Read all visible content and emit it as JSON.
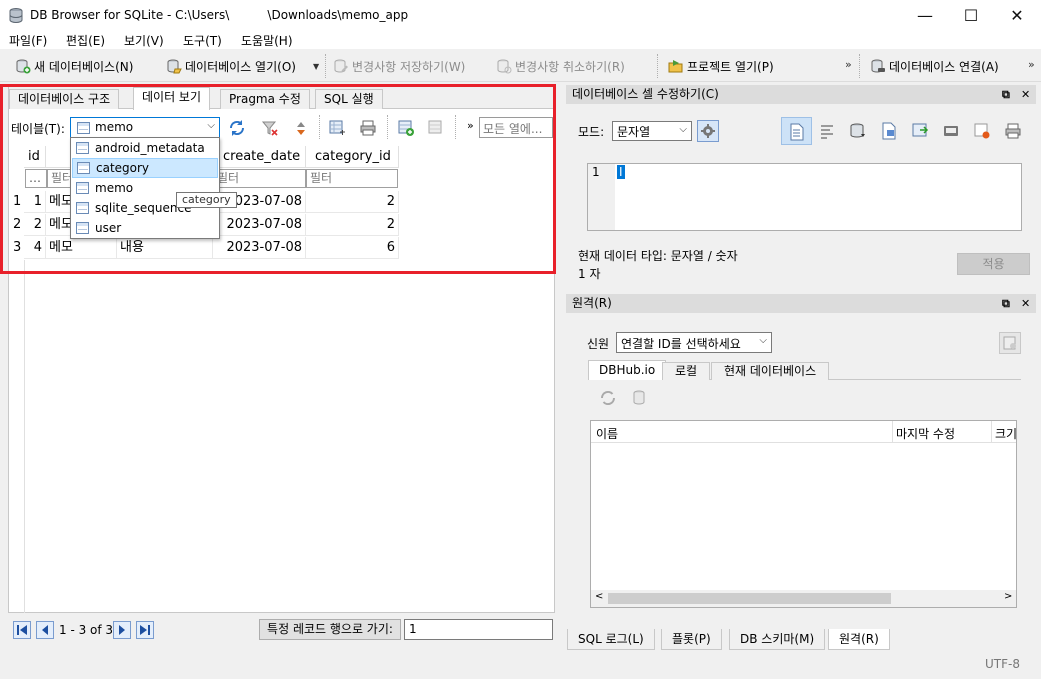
{
  "window": {
    "title": "DB Browser for SQLite - C:\\Users\\          \\Downloads\\memo_app",
    "minimize": "—",
    "maximize": "☐",
    "close": "✕"
  },
  "menu": [
    "파일(F)",
    "편집(E)",
    "보기(V)",
    "도구(T)",
    "도움말(H)"
  ],
  "toolbar": {
    "new_db": "새 데이터베이스(N)",
    "open_db": "데이터베이스 열기(O)",
    "write_changes": "변경사항 저장하기(W)",
    "revert_changes": "변경사항 취소하기(R)",
    "open_project": "프로젝트 열기(P)",
    "attach_db": "데이터베이스 연결(A)",
    "more": "»"
  },
  "left": {
    "tabs": [
      "데이터베이스 구조",
      "데이터 보기",
      "Pragma 수정",
      "SQL 실행"
    ],
    "active_tab": 1,
    "table_label": "테이블(T):",
    "table_selected": "memo",
    "more": "»",
    "filter_placeholder": "모든 열에...",
    "columns": [
      "id",
      "",
      "",
      "create_date",
      "category_id"
    ],
    "filter_text": "필터",
    "filter_dots": "…",
    "rows": [
      {
        "num": "1",
        "id": "1",
        "title": "메모",
        "content": "",
        "date": "2023-07-08",
        "cat": "2"
      },
      {
        "num": "2",
        "id": "2",
        "title": "메모",
        "content": "",
        "date": "2023-07-08",
        "cat": "2"
      },
      {
        "num": "3",
        "id": "4",
        "title": "메모",
        "content": "내용",
        "date": "2023-07-08",
        "cat": "6"
      }
    ],
    "dropdown": [
      "android_metadata",
      "category",
      "memo",
      "sqlite_sequence",
      "user"
    ],
    "dropdown_selected": 1,
    "tooltip": "category",
    "nav_text": "1 - 3 of 3",
    "goto_label": "특정 레코드 행으로 가기:",
    "goto_value": "1"
  },
  "edit_cell": {
    "title": "데이터베이스 셀 수정하기(C)",
    "mode_label": "모드:",
    "mode_value": "문자열",
    "line_number": "1",
    "cursor": "I",
    "type_info": "현재 데이터 타입: 문자열 / 숫자",
    "size_info": "1 자",
    "apply": "적용"
  },
  "remote": {
    "title": "원격(R)",
    "identity_label": "신원",
    "identity_value": "연결할 ID를 선택하세요",
    "tabs": [
      "DBHub.io",
      "로컬",
      "현재 데이터베이스"
    ],
    "col_name": "이름",
    "col_modified": "마지막 수정",
    "col_size": "크기"
  },
  "bottom_tabs": [
    "SQL 로그(L)",
    "플롯(P)",
    "DB 스키마(M)",
    "원격(R)"
  ],
  "bottom_active": 3,
  "encoding": "UTF-8",
  "colors": {
    "highlight": "#e8202a",
    "selection": "#cce8ff",
    "panel_title": "#dcdcdc"
  }
}
